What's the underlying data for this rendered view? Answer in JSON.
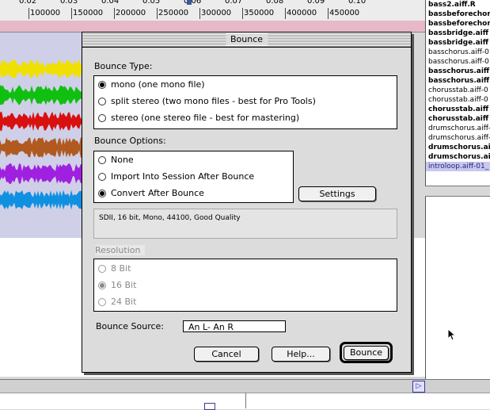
{
  "ruler": {
    "top_labels": [
      "0.02",
      "0.03",
      "0.04",
      "0.05",
      "0.06",
      "0.07",
      "0.08",
      "0.09",
      "0.10"
    ],
    "labels": [
      "100000",
      "150000",
      "200000",
      "250000",
      "300000",
      "350000",
      "400000",
      "450000"
    ]
  },
  "files": [
    {
      "name": "bass2.aiff.R",
      "bold": true,
      "selected": false
    },
    {
      "name": "bassbeforechor",
      "bold": true,
      "selected": false
    },
    {
      "name": "bassbeforechor",
      "bold": true,
      "selected": false
    },
    {
      "name": "bassbridge.aiff",
      "bold": true,
      "selected": false
    },
    {
      "name": "bassbridge.aiff",
      "bold": true,
      "selected": false
    },
    {
      "name": "basschorus.aiff-0",
      "bold": false,
      "selected": false
    },
    {
      "name": "basschorus.aiff-0",
      "bold": false,
      "selected": false
    },
    {
      "name": "basschorus.aiff",
      "bold": true,
      "selected": false
    },
    {
      "name": "basschorus.aiff",
      "bold": true,
      "selected": false
    },
    {
      "name": "chorusstab.aiff-0",
      "bold": false,
      "selected": false
    },
    {
      "name": "chorusstab.aiff-0",
      "bold": false,
      "selected": false
    },
    {
      "name": "chorusstab.aiff",
      "bold": true,
      "selected": false
    },
    {
      "name": "chorusstab.aiff",
      "bold": true,
      "selected": false
    },
    {
      "name": "drumschorus.aiff-",
      "bold": false,
      "selected": false
    },
    {
      "name": "drumschorus.aiff-",
      "bold": false,
      "selected": false
    },
    {
      "name": "drumschorus.ai",
      "bold": true,
      "selected": false
    },
    {
      "name": "drumschorus.ai",
      "bold": true,
      "selected": false
    },
    {
      "name": "introloop.aiff-01_",
      "bold": false,
      "selected": true
    }
  ],
  "track_colors": [
    "#f0e000",
    "#10c010",
    "#d81010",
    "#b05a20",
    "#a020e0",
    "#1090e0"
  ],
  "dialog": {
    "title": "Bounce",
    "bounce_type": {
      "label": "Bounce Type:",
      "options": [
        {
          "label": "mono (one mono file)",
          "selected": true
        },
        {
          "label": "split stereo (two mono files - best for Pro Tools)",
          "selected": false
        },
        {
          "label": "stereo (one stereo file - best for mastering)",
          "selected": false
        }
      ]
    },
    "bounce_options": {
      "label": "Bounce Options:",
      "options": [
        {
          "label": "None",
          "selected": false
        },
        {
          "label": "Import Into Session After Bounce",
          "selected": false
        },
        {
          "label": "Convert After Bounce",
          "selected": true
        }
      ]
    },
    "settings_button": "Settings",
    "info_text": "SDII, 16 bit, Mono, 44100, Good Quality",
    "resolution": {
      "label": "Resolution",
      "options": [
        {
          "label": "8 Bit",
          "selected": false
        },
        {
          "label": "16 Bit",
          "selected": true
        },
        {
          "label": "24 Bit",
          "selected": false
        }
      ]
    },
    "bounce_source": {
      "label": "Bounce Source:",
      "value": "An L- An R"
    },
    "buttons": {
      "cancel": "Cancel",
      "help": "Help...",
      "bounce": "Bounce"
    }
  }
}
